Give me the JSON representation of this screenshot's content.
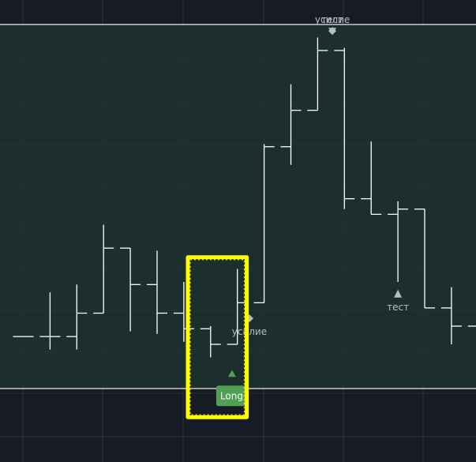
{
  "chart_data": {
    "type": "ohlc",
    "y_axis_range": [
      -1.5,
      12.5
    ],
    "x_range": [
      -0.5,
      17.5
    ],
    "grid": true,
    "colors": {
      "page_bg": "#161b25",
      "panel_bg": "#1c2f2c",
      "grid": "#2a3a3a",
      "bars": "#ffffff",
      "panel_border": "#c9ccd1",
      "annotation_text": "#b9bcc1",
      "signal_green": "#4f9f54",
      "highlight": "#ffff00"
    },
    "bars": [
      {
        "x": 0,
        "open": 0.5,
        "high": 0.5,
        "low": 0.5,
        "close": 0.5
      },
      {
        "x": 1,
        "open": 0.5,
        "high": 2.2,
        "low": 0.0,
        "close": 0.5
      },
      {
        "x": 2,
        "open": 0.5,
        "high": 2.5,
        "low": 0.0,
        "close": 1.4
      },
      {
        "x": 3,
        "open": 1.4,
        "high": 4.8,
        "low": 1.4,
        "close": 3.9
      },
      {
        "x": 4,
        "open": 3.9,
        "high": 3.9,
        "low": 0.7,
        "close": 2.5
      },
      {
        "x": 5,
        "open": 2.5,
        "high": 3.8,
        "low": 0.6,
        "close": 1.4
      },
      {
        "x": 6,
        "open": 1.4,
        "high": 2.6,
        "low": 0.3,
        "close": 0.8
      },
      {
        "x": 7,
        "open": 0.8,
        "high": 0.9,
        "low": -0.3,
        "close": 0.2
      },
      {
        "x": 8,
        "open": 0.2,
        "high": 3.1,
        "low": 0.2,
        "close": 1.8
      },
      {
        "x": 9,
        "open": 1.8,
        "high": 7.9,
        "low": 1.8,
        "close": 7.8
      },
      {
        "x": 10,
        "open": 7.8,
        "high": 10.2,
        "low": 7.1,
        "close": 9.2
      },
      {
        "x": 11,
        "open": 9.2,
        "high": 12.0,
        "low": 9.2,
        "close": 11.5
      },
      {
        "x": 12,
        "open": 11.5,
        "high": 11.6,
        "low": 5.4,
        "close": 5.8
      },
      {
        "x": 13,
        "open": 5.8,
        "high": 8.0,
        "low": 5.2,
        "close": 5.2
      },
      {
        "x": 14,
        "open": 5.2,
        "high": 5.7,
        "low": 2.6,
        "close": 5.4
      },
      {
        "x": 15,
        "open": 5.4,
        "high": 5.4,
        "low": 1.6,
        "close": 1.6
      },
      {
        "x": 16,
        "open": 1.6,
        "high": 2.4,
        "low": 0.2,
        "close": 0.9
      },
      {
        "x": 17,
        "open": 0.9,
        "high": 2.4,
        "low": 0.2,
        "close": 0.2
      }
    ],
    "annotations": [
      {
        "text": "усилие",
        "x": 11.55,
        "y": 12.25,
        "marker": "diamond",
        "placement": "above"
      },
      {
        "text": "тест",
        "x": 11.55,
        "y": 12.25,
        "marker": "triangle-down",
        "placement": "above"
      },
      {
        "text": "усилие",
        "x": 8.45,
        "y": 1.2,
        "marker": "diamond",
        "placement": "below"
      },
      {
        "text": "тест",
        "x": 14.0,
        "y": 2.15,
        "marker": "triangle-up",
        "placement": "below"
      }
    ],
    "signal": {
      "text": "Long",
      "x": 7.8,
      "y": -0.9,
      "marker": "triangle-up"
    },
    "highlight_box": {
      "x_from": 6.15,
      "x_to": 8.35,
      "y_from": -2.6,
      "y_to": 3.55
    }
  }
}
